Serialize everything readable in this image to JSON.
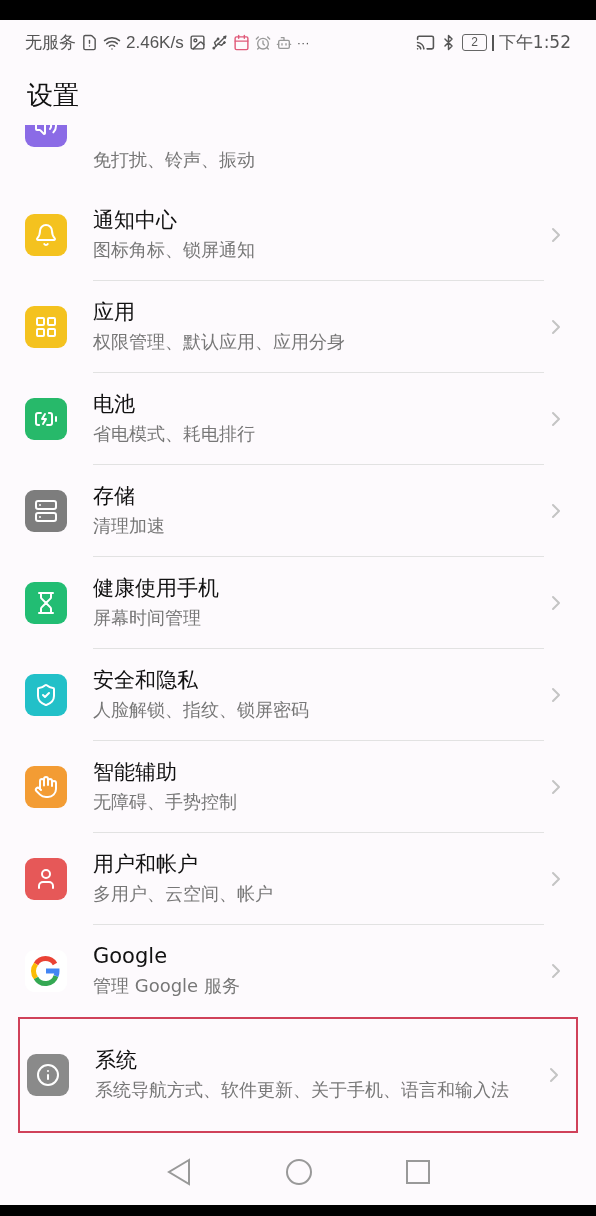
{
  "status_bar": {
    "carrier": "无服务",
    "speed": "2.46K/s",
    "more": "···",
    "battery": "2",
    "time": "下午1:52"
  },
  "header": {
    "title": "设置"
  },
  "partial_item": {
    "kind": "sound",
    "color": "#8b6be6",
    "subtitle": "免打扰、铃声、振动"
  },
  "items": [
    {
      "kind": "bell",
      "color": "#f4c21f",
      "title": "通知中心",
      "subtitle": "图标角标、锁屏通知",
      "highlighted": false
    },
    {
      "kind": "apps",
      "color": "#f4c21f",
      "title": "应用",
      "subtitle": "权限管理、默认应用、应用分身",
      "highlighted": false
    },
    {
      "kind": "battery",
      "color": "#27b96a",
      "title": "电池",
      "subtitle": "省电模式、耗电排行",
      "highlighted": false
    },
    {
      "kind": "storage",
      "color": "#7d7d7d",
      "title": "存储",
      "subtitle": "清理加速",
      "highlighted": false
    },
    {
      "kind": "hourglass",
      "color": "#22bd73",
      "title": "健康使用手机",
      "subtitle": "屏幕时间管理",
      "highlighted": false
    },
    {
      "kind": "shield",
      "color": "#22c0c8",
      "title": "安全和隐私",
      "subtitle": "人脸解锁、指纹、锁屏密码",
      "highlighted": false
    },
    {
      "kind": "hand",
      "color": "#f39c34",
      "title": "智能辅助",
      "subtitle": "无障碍、手势控制",
      "highlighted": false
    },
    {
      "kind": "user",
      "color": "#e65858",
      "title": "用户和帐户",
      "subtitle": "多用户、云空间、帐户",
      "highlighted": false
    },
    {
      "kind": "google",
      "color": "#ffffff",
      "title": "Google",
      "subtitle": "管理 Google 服务",
      "highlighted": false
    },
    {
      "kind": "system",
      "color": "#8a8a8a",
      "title": "系统",
      "subtitle": "系统导航方式、软件更新、关于手机、语言和输入法",
      "highlighted": true
    }
  ]
}
